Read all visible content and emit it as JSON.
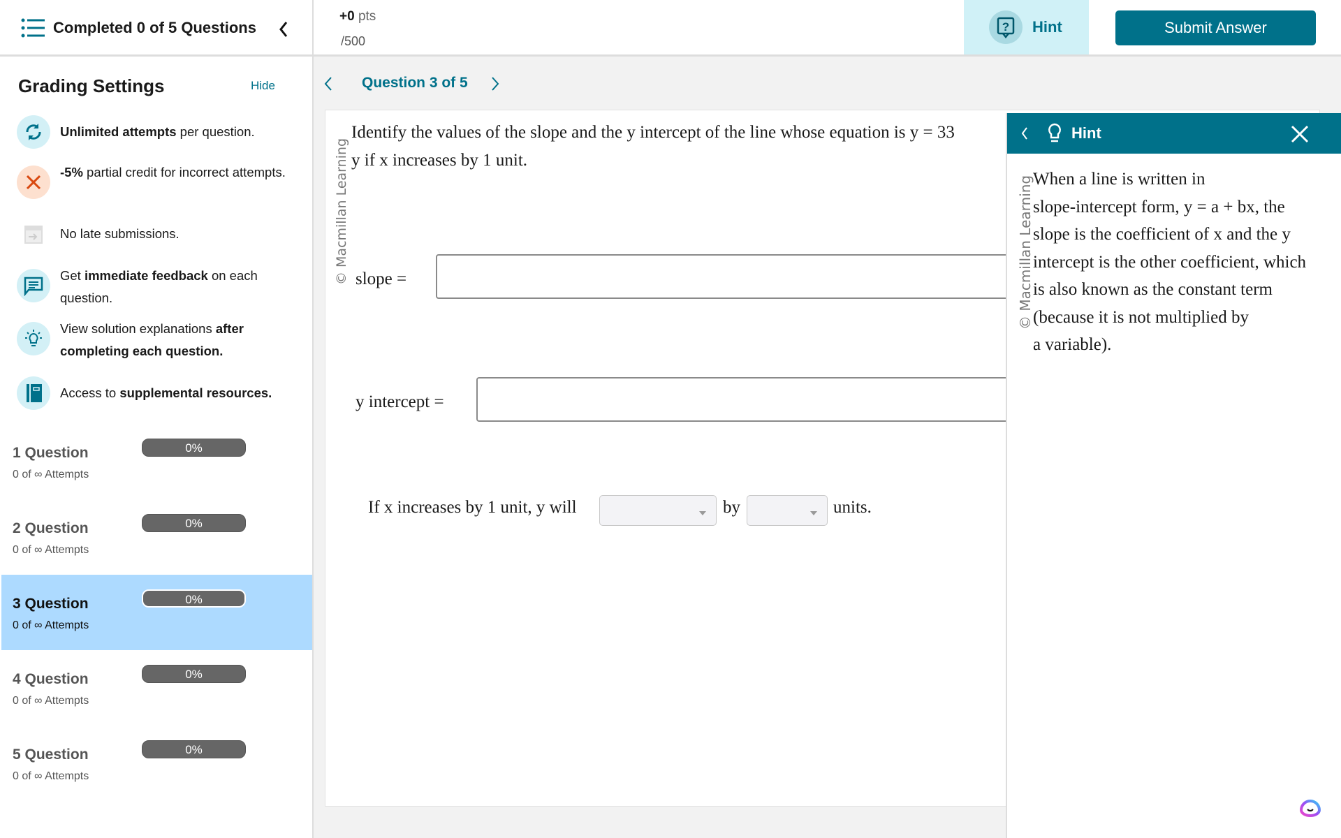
{
  "sidebar": {
    "header_title": "Completed 0 of 5 Questions",
    "grading_title": "Grading Settings",
    "hide_label": "Hide",
    "settings": [
      {
        "icon": "refresh-icon",
        "parts": [
          {
            "t": "Unlimited attempts",
            "b": true
          },
          {
            "t": " per question.",
            "b": false
          }
        ]
      },
      {
        "icon": "x-icon",
        "parts": [
          {
            "t": "-5%",
            "b": true
          },
          {
            "t": " partial credit for incorrect attempts.",
            "b": false
          }
        ]
      },
      {
        "icon": "calendar-late-icon",
        "parts": [
          {
            "t": "No late submissions.",
            "b": false
          }
        ]
      },
      {
        "icon": "chat-feedback-icon",
        "parts": [
          {
            "t": "Get ",
            "b": false
          },
          {
            "t": "immediate feedback",
            "b": true
          },
          {
            "t": " on each question.",
            "b": false
          }
        ]
      },
      {
        "icon": "lightbulb-icon",
        "parts": [
          {
            "t": "View solution explanations ",
            "b": false
          },
          {
            "t": "after completing each question.",
            "b": true
          }
        ]
      },
      {
        "icon": "book-icon",
        "parts": [
          {
            "t": "Access to ",
            "b": false
          },
          {
            "t": "supplemental resources.",
            "b": true
          }
        ]
      }
    ],
    "questions": [
      {
        "title": "1 Question",
        "attempts": "0 of ∞ Attempts",
        "progress": "0%",
        "active": false
      },
      {
        "title": "2 Question",
        "attempts": "0 of ∞ Attempts",
        "progress": "0%",
        "active": false
      },
      {
        "title": "3 Question",
        "attempts": "0 of ∞ Attempts",
        "progress": "0%",
        "active": true
      },
      {
        "title": "4 Question",
        "attempts": "0 of ∞ Attempts",
        "progress": "0%",
        "active": false
      },
      {
        "title": "5 Question",
        "attempts": "0 of ∞ Attempts",
        "progress": "0%",
        "active": false
      }
    ]
  },
  "topbar": {
    "points_value": "+0",
    "points_unit": "pts",
    "points_total": "/500",
    "hint_label": "Hint",
    "submit_label": "Submit Answer"
  },
  "nav": {
    "question_label": "Question 3 of 5"
  },
  "question": {
    "watermark": "© Macmillan Learning",
    "prompt_line1": "Identify the values of the slope and the y intercept of the line whose equation is y = 33",
    "prompt_line2": "y if x increases by 1 unit.",
    "slope_label": "slope =",
    "slope_value": "",
    "intercept_label": "y intercept =",
    "intercept_value": "",
    "sentence_start": "If x increases by 1 unit, y will",
    "sentence_by": "by",
    "sentence_end": "units.",
    "select1_value": "",
    "select2_value": ""
  },
  "hint_panel": {
    "title": "Hint",
    "watermark": "© Macmillan Learning",
    "lines": [
      "When a line is written in",
      "slope-intercept form, y = a + bx, the",
      "slope is the coefficient of x and the y",
      "intercept is the other coefficient, which",
      "is also known as the constant term",
      "(because it is not multiplied by",
      "a variable)."
    ]
  },
  "colors": {
    "teal": "#00718a",
    "hint_bg": "#d0f1f7",
    "active_row": "#addaff",
    "icon_bg": "#d3f0f6",
    "x_icon_bg": "#fde0cf",
    "x_icon": "#d9480f"
  }
}
